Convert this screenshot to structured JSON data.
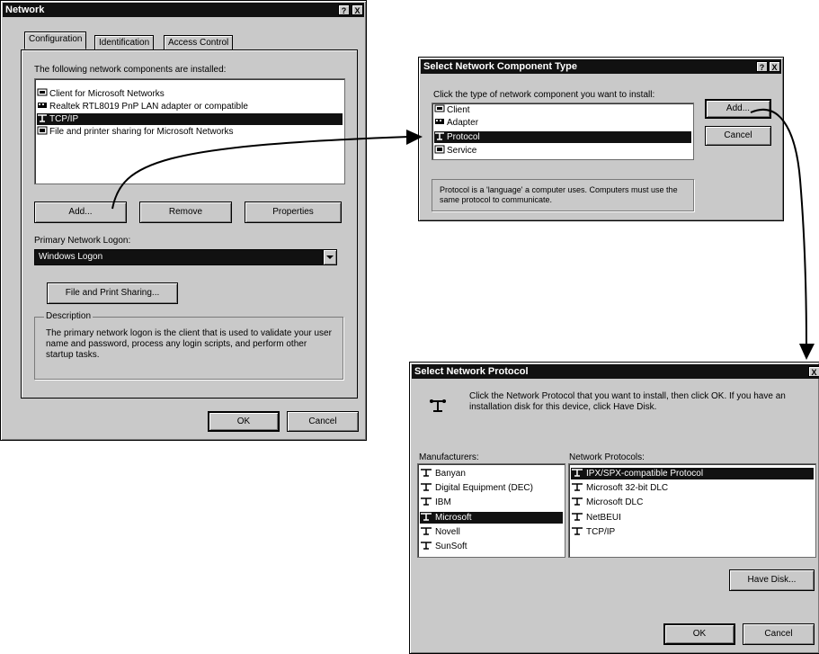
{
  "network_dialog": {
    "title": "Network",
    "help_btn": "?",
    "close_btn": "X",
    "tabs": [
      "Configuration",
      "Identification",
      "Access Control"
    ],
    "installed_label": "The following network components are installed:",
    "components": [
      {
        "label": "Client for Microsoft Networks",
        "icon": "client-icon"
      },
      {
        "label": "Realtek RTL8019 PnP LAN adapter or compatible",
        "icon": "adapter-icon"
      },
      {
        "label": "TCP/IP",
        "icon": "protocol-icon",
        "selected": true
      },
      {
        "label": "File and printer sharing for Microsoft Networks",
        "icon": "service-icon"
      }
    ],
    "add_label": "Add...",
    "remove_label": "Remove",
    "properties_label": "Properties",
    "primary_logon_label": "Primary Network Logon:",
    "primary_logon_value": "Windows Logon",
    "file_print_label": "File and Print Sharing...",
    "description_title": "Description",
    "description_text": "The primary network logon is the client that is used to validate your user name and password, process any login scripts, and perform other startup tasks.",
    "ok_label": "OK",
    "cancel_label": "Cancel"
  },
  "component_type_dialog": {
    "title": "Select Network Component Type",
    "help_btn": "?",
    "close_btn": "X",
    "prompt": "Click the type of network component you want to install:",
    "types": [
      {
        "label": "Client",
        "icon": "client-icon"
      },
      {
        "label": "Adapter",
        "icon": "adapter-icon"
      },
      {
        "label": "Protocol",
        "icon": "protocol-icon",
        "selected": true
      },
      {
        "label": "Service",
        "icon": "service-icon"
      }
    ],
    "description": "Protocol is a 'language' a computer uses. Computers must use the same protocol to communicate.",
    "add_label": "Add...",
    "cancel_label": "Cancel"
  },
  "protocol_dialog": {
    "title": "Select Network Protocol",
    "close_btn": "X",
    "instruction": "Click the Network Protocol that you want to install, then click OK. If you have an installation disk for this device, click Have Disk.",
    "manufacturers_label": "Manufacturers:",
    "protocols_label": "Network Protocols:",
    "manufacturers": [
      {
        "label": "Banyan"
      },
      {
        "label": "Digital Equipment (DEC)"
      },
      {
        "label": "IBM"
      },
      {
        "label": "Microsoft",
        "selected": true
      },
      {
        "label": "Novell"
      },
      {
        "label": "SunSoft"
      }
    ],
    "protocols": [
      {
        "label": "IPX/SPX-compatible Protocol",
        "selected": true
      },
      {
        "label": "Microsoft 32-bit DLC"
      },
      {
        "label": "Microsoft DLC"
      },
      {
        "label": "NetBEUI"
      },
      {
        "label": "TCP/IP"
      }
    ],
    "have_disk_label": "Have Disk...",
    "ok_label": "OK",
    "cancel_label": "Cancel"
  }
}
